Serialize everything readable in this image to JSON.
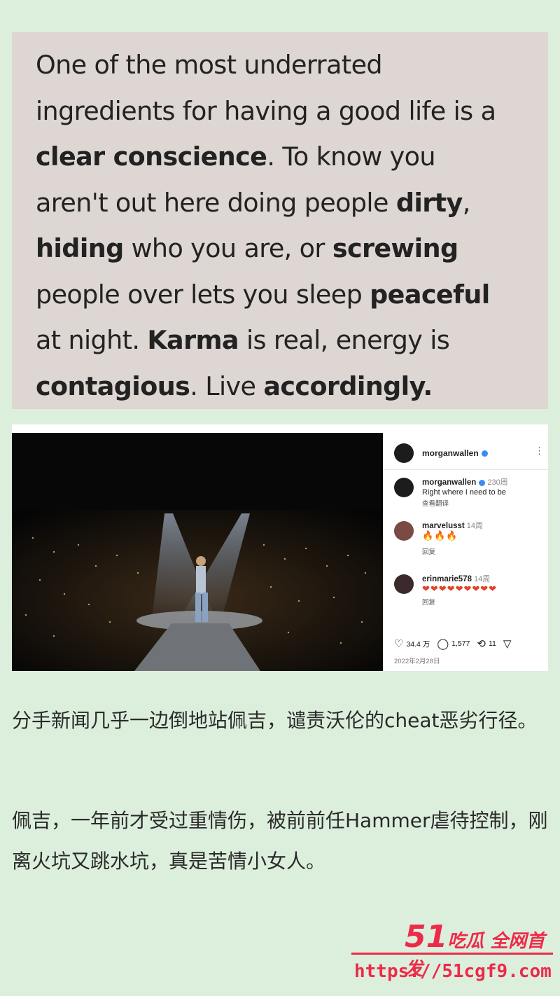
{
  "quote": {
    "segments": [
      {
        "t": "One of the most underrated\ningredients for having a good life is a\n",
        "b": false
      },
      {
        "t": "clear conscience",
        "b": true
      },
      {
        "t": ". To know you\naren't out here doing people ",
        "b": false
      },
      {
        "t": "dirty",
        "b": true
      },
      {
        "t": ",\n",
        "b": false
      },
      {
        "t": "hiding",
        "b": true
      },
      {
        "t": " who you are, or ",
        "b": false
      },
      {
        "t": "screwing",
        "b": true
      },
      {
        "t": "\npeople over lets you sleep ",
        "b": false
      },
      {
        "t": "peaceful",
        "b": true
      },
      {
        "t": "\nat night. ",
        "b": false
      },
      {
        "t": "Karma",
        "b": true
      },
      {
        "t": " is real, energy is\n",
        "b": false
      },
      {
        "t": "contagious",
        "b": true
      },
      {
        "t": ". Live ",
        "b": false
      },
      {
        "t": "accordingly.",
        "b": true
      }
    ]
  },
  "post": {
    "header_user": "morganwallen",
    "comments": [
      {
        "user": "morganwallen",
        "time": "230周",
        "text": "Right where I need to be",
        "sub": "查看翻译",
        "verified": true
      },
      {
        "user": "marvelusst",
        "time": "14周",
        "text": "🔥🔥🔥",
        "sub": "回复",
        "verified": false
      },
      {
        "user": "erinmarie578",
        "time": "14周",
        "text": "❤❤❤❤❤❤❤❤❤",
        "sub": "回复",
        "verified": false
      }
    ],
    "likes": "34.4 万",
    "comments_count": "1,577",
    "shares": "11",
    "date": "2022年2月28日"
  },
  "text": {
    "para1": "分手新闻几乎一边倒地站佩吉，谴责沃伦的cheat恶劣行径。",
    "para2": "佩吉，一年前才受过重情伤，被前前任Hammer虐待控制，刚离火坑又跳水坑，真是苦情小女人。"
  },
  "watermark": {
    "logo_num": "51",
    "logo_text": "吃瓜 全网首发",
    "url": "https://51cgf9.com"
  },
  "colors": {
    "accent": "#ee2a4a",
    "verified": "#3a8cf3"
  }
}
